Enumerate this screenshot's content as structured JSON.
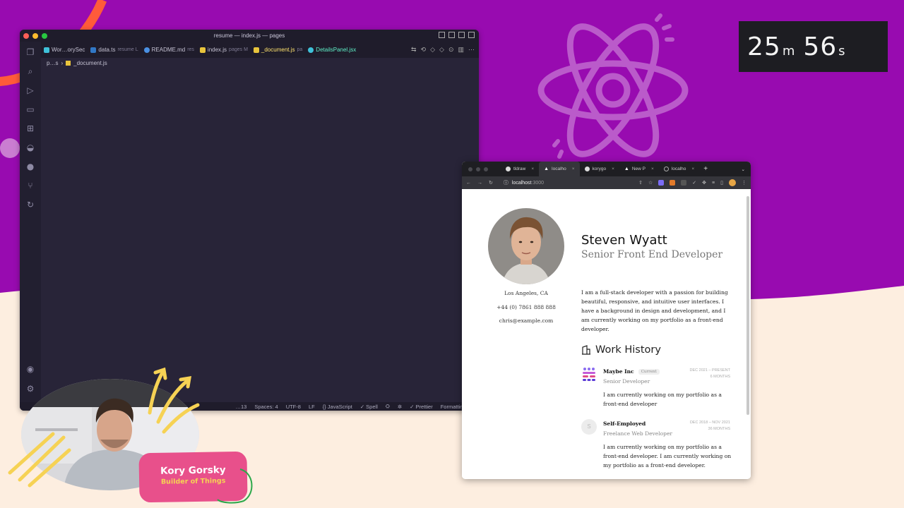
{
  "timer": {
    "minutes": "25",
    "minutes_unit": "m",
    "seconds": "56",
    "seconds_unit": "s"
  },
  "vscode": {
    "title": "resume — index.js — pages",
    "tabs": [
      {
        "label": "Wor…orySec",
        "sub": "",
        "icon": "react-icon"
      },
      {
        "label": "data.ts",
        "sub": "resume L",
        "icon": "ts-icon"
      },
      {
        "label": "README.md",
        "sub": "res",
        "icon": "info-icon"
      },
      {
        "label": "index.js",
        "sub": "pages M",
        "icon": "js-icon"
      },
      {
        "label": "_document.js",
        "sub": "pa",
        "icon": "js-icon"
      },
      {
        "label": "DetailsPanel.jsx",
        "sub": "",
        "icon": "react-icon"
      }
    ],
    "breadcrumb": {
      "folder": "p…s",
      "file": "_document.js"
    },
    "status": {
      "cursor": "…13",
      "spaces": "Spaces: 4",
      "encoding": "UTF-8",
      "eol": "LF",
      "language": "{} JavaScript",
      "spell": "✓ Spell",
      "prettier": "✓ Prettier",
      "formatting": "Formatting: ✓"
    }
  },
  "browser": {
    "tabs": [
      {
        "label": "tldraw",
        "active": false
      },
      {
        "label": "localho",
        "active": true
      },
      {
        "label": "korygo",
        "active": false
      },
      {
        "label": "New P",
        "active": false
      },
      {
        "label": "localho",
        "active": false
      }
    ],
    "new_tab": "+",
    "url_host": "localhost",
    "url_port": ":3000"
  },
  "resume": {
    "name": "Steven Wyatt",
    "role": "Senior Front End Developer",
    "location": "Los Angeles, CA",
    "phone": "+44 (0) 7861 888 888",
    "email": "chris@example.com",
    "bio": "I am a full-stack developer with a passion for building beautiful, responsive, and intuitive user interfaces. I have a background in design and development, and I am currently working on my portfolio as a front-end developer.",
    "work_history_heading": "Work History",
    "jobs": [
      {
        "company": "Maybe Inc",
        "badge": "Current",
        "title": "Senior Developer",
        "dates": "DEC 2021 – PRESENT",
        "duration": "6 MONTHS",
        "description": "I am currently working on my portfolio as a front-end developer"
      },
      {
        "company": "Self-Employed",
        "logo_letter": "S",
        "badge": "",
        "title": "Freelance Web Developer",
        "dates": "DEC 2018 – NOV 2021",
        "duration": "36 MONTHS",
        "description": "I am currently working on my portfolio as a front-end developer. I am currently working on my portfolio as a front-end developer."
      }
    ]
  },
  "presenter": {
    "name": "Kory Gorsky",
    "tagline": "Builder of Things"
  },
  "colors": {
    "purple_bg": "#980bb0",
    "cream_bg": "#fdeee0",
    "vscode_bg": "#282438",
    "accent_teal": "#5ff0c8",
    "nametag_pink": "#e8508b",
    "tagline_yellow": "#f6d254"
  }
}
